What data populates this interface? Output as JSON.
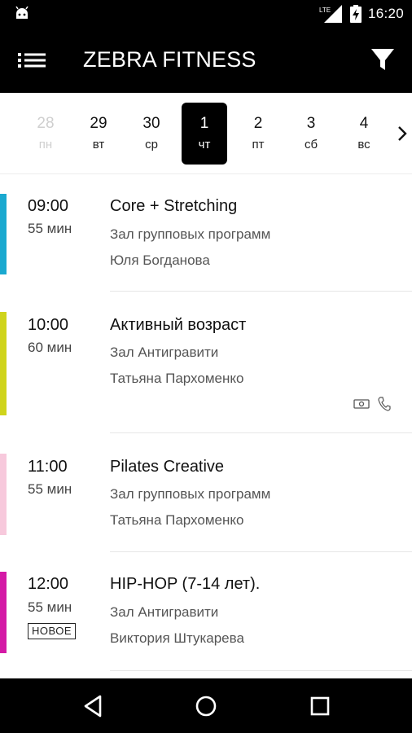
{
  "status_bar": {
    "network": "LTE",
    "time": "16:20",
    "icons": [
      "android-icon",
      "lte-signal-icon",
      "battery-charging-icon"
    ]
  },
  "app_bar": {
    "title": "ZEBRA FITNESS",
    "icons": [
      "menu-icon",
      "filter-icon"
    ]
  },
  "days": [
    {
      "num": "28",
      "dow": "пн",
      "state": "past"
    },
    {
      "num": "29",
      "dow": "вт",
      "state": "normal"
    },
    {
      "num": "30",
      "dow": "ср",
      "state": "normal"
    },
    {
      "num": "1",
      "dow": "чт",
      "state": "selected"
    },
    {
      "num": "2",
      "dow": "пт",
      "state": "normal"
    },
    {
      "num": "3",
      "dow": "сб",
      "state": "normal"
    },
    {
      "num": "4",
      "dow": "вс",
      "state": "normal"
    }
  ],
  "classes": [
    {
      "time": "09:00",
      "duration": "55 мин",
      "name": "Core + Stretching",
      "hall": "Зал групповых программ",
      "trainer": "Юля Богданова",
      "color": "#1aa9d0",
      "badge": "",
      "icons": []
    },
    {
      "time": "10:00",
      "duration": "60 мин",
      "name": "Активный возраст",
      "hall": "Зал Антигравити",
      "trainer": "Татьяна Пархоменко",
      "color": "#cfd41c",
      "badge": "",
      "icons": [
        "cash-icon",
        "phone-icon"
      ]
    },
    {
      "time": "11:00",
      "duration": "55 мин",
      "name": "Pilates Creative",
      "hall": "Зал групповых программ",
      "trainer": "Татьяна Пархоменко",
      "color": "#f7c9dc",
      "badge": "",
      "icons": []
    },
    {
      "time": "12:00",
      "duration": "55 мин",
      "name": "HIP-HOP (7-14 лет).",
      "hall": "Зал Антигравити",
      "trainer": "Виктория Штукарева",
      "color": "#d41aa6",
      "badge": "НОВОЕ",
      "icons": []
    }
  ],
  "nav_bar": {
    "icons": [
      "back-icon",
      "home-icon",
      "recents-icon"
    ]
  }
}
